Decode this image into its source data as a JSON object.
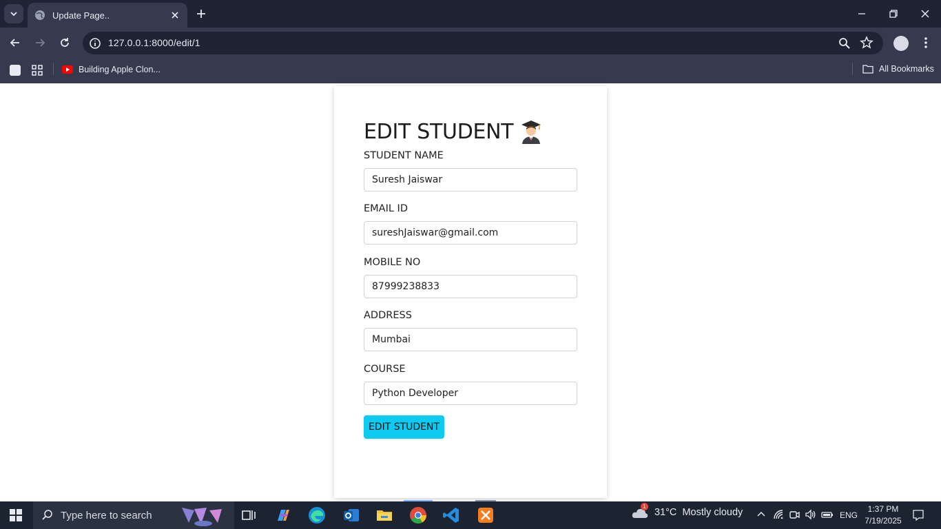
{
  "browser": {
    "tab_title": "Update Page..",
    "url": "127.0.0.1:8000/edit/1",
    "bookmark": "Building Apple Clon...",
    "all_bookmarks": "All Bookmarks"
  },
  "form": {
    "heading": "EDIT STUDENT",
    "fields": [
      {
        "label": "STUDENT NAME",
        "value": "Suresh Jaiswar"
      },
      {
        "label": "EMAIL ID",
        "value": "sureshJaiswar@gmail.com"
      },
      {
        "label": "MOBILE NO",
        "value": "87999238833"
      },
      {
        "label": "ADDRESS",
        "value": "Mumbai"
      },
      {
        "label": "COURSE",
        "value": "Python Developer"
      }
    ],
    "submit_label": "EDIT STUDENT",
    "submit_color": "#0dcaf0"
  },
  "taskbar": {
    "search_placeholder": "Type here to search",
    "weather": "31°C  Mostly cloudy",
    "weather_badge": "1",
    "language": "ENG",
    "time": "1:37 PM",
    "date": "7/19/2025"
  }
}
